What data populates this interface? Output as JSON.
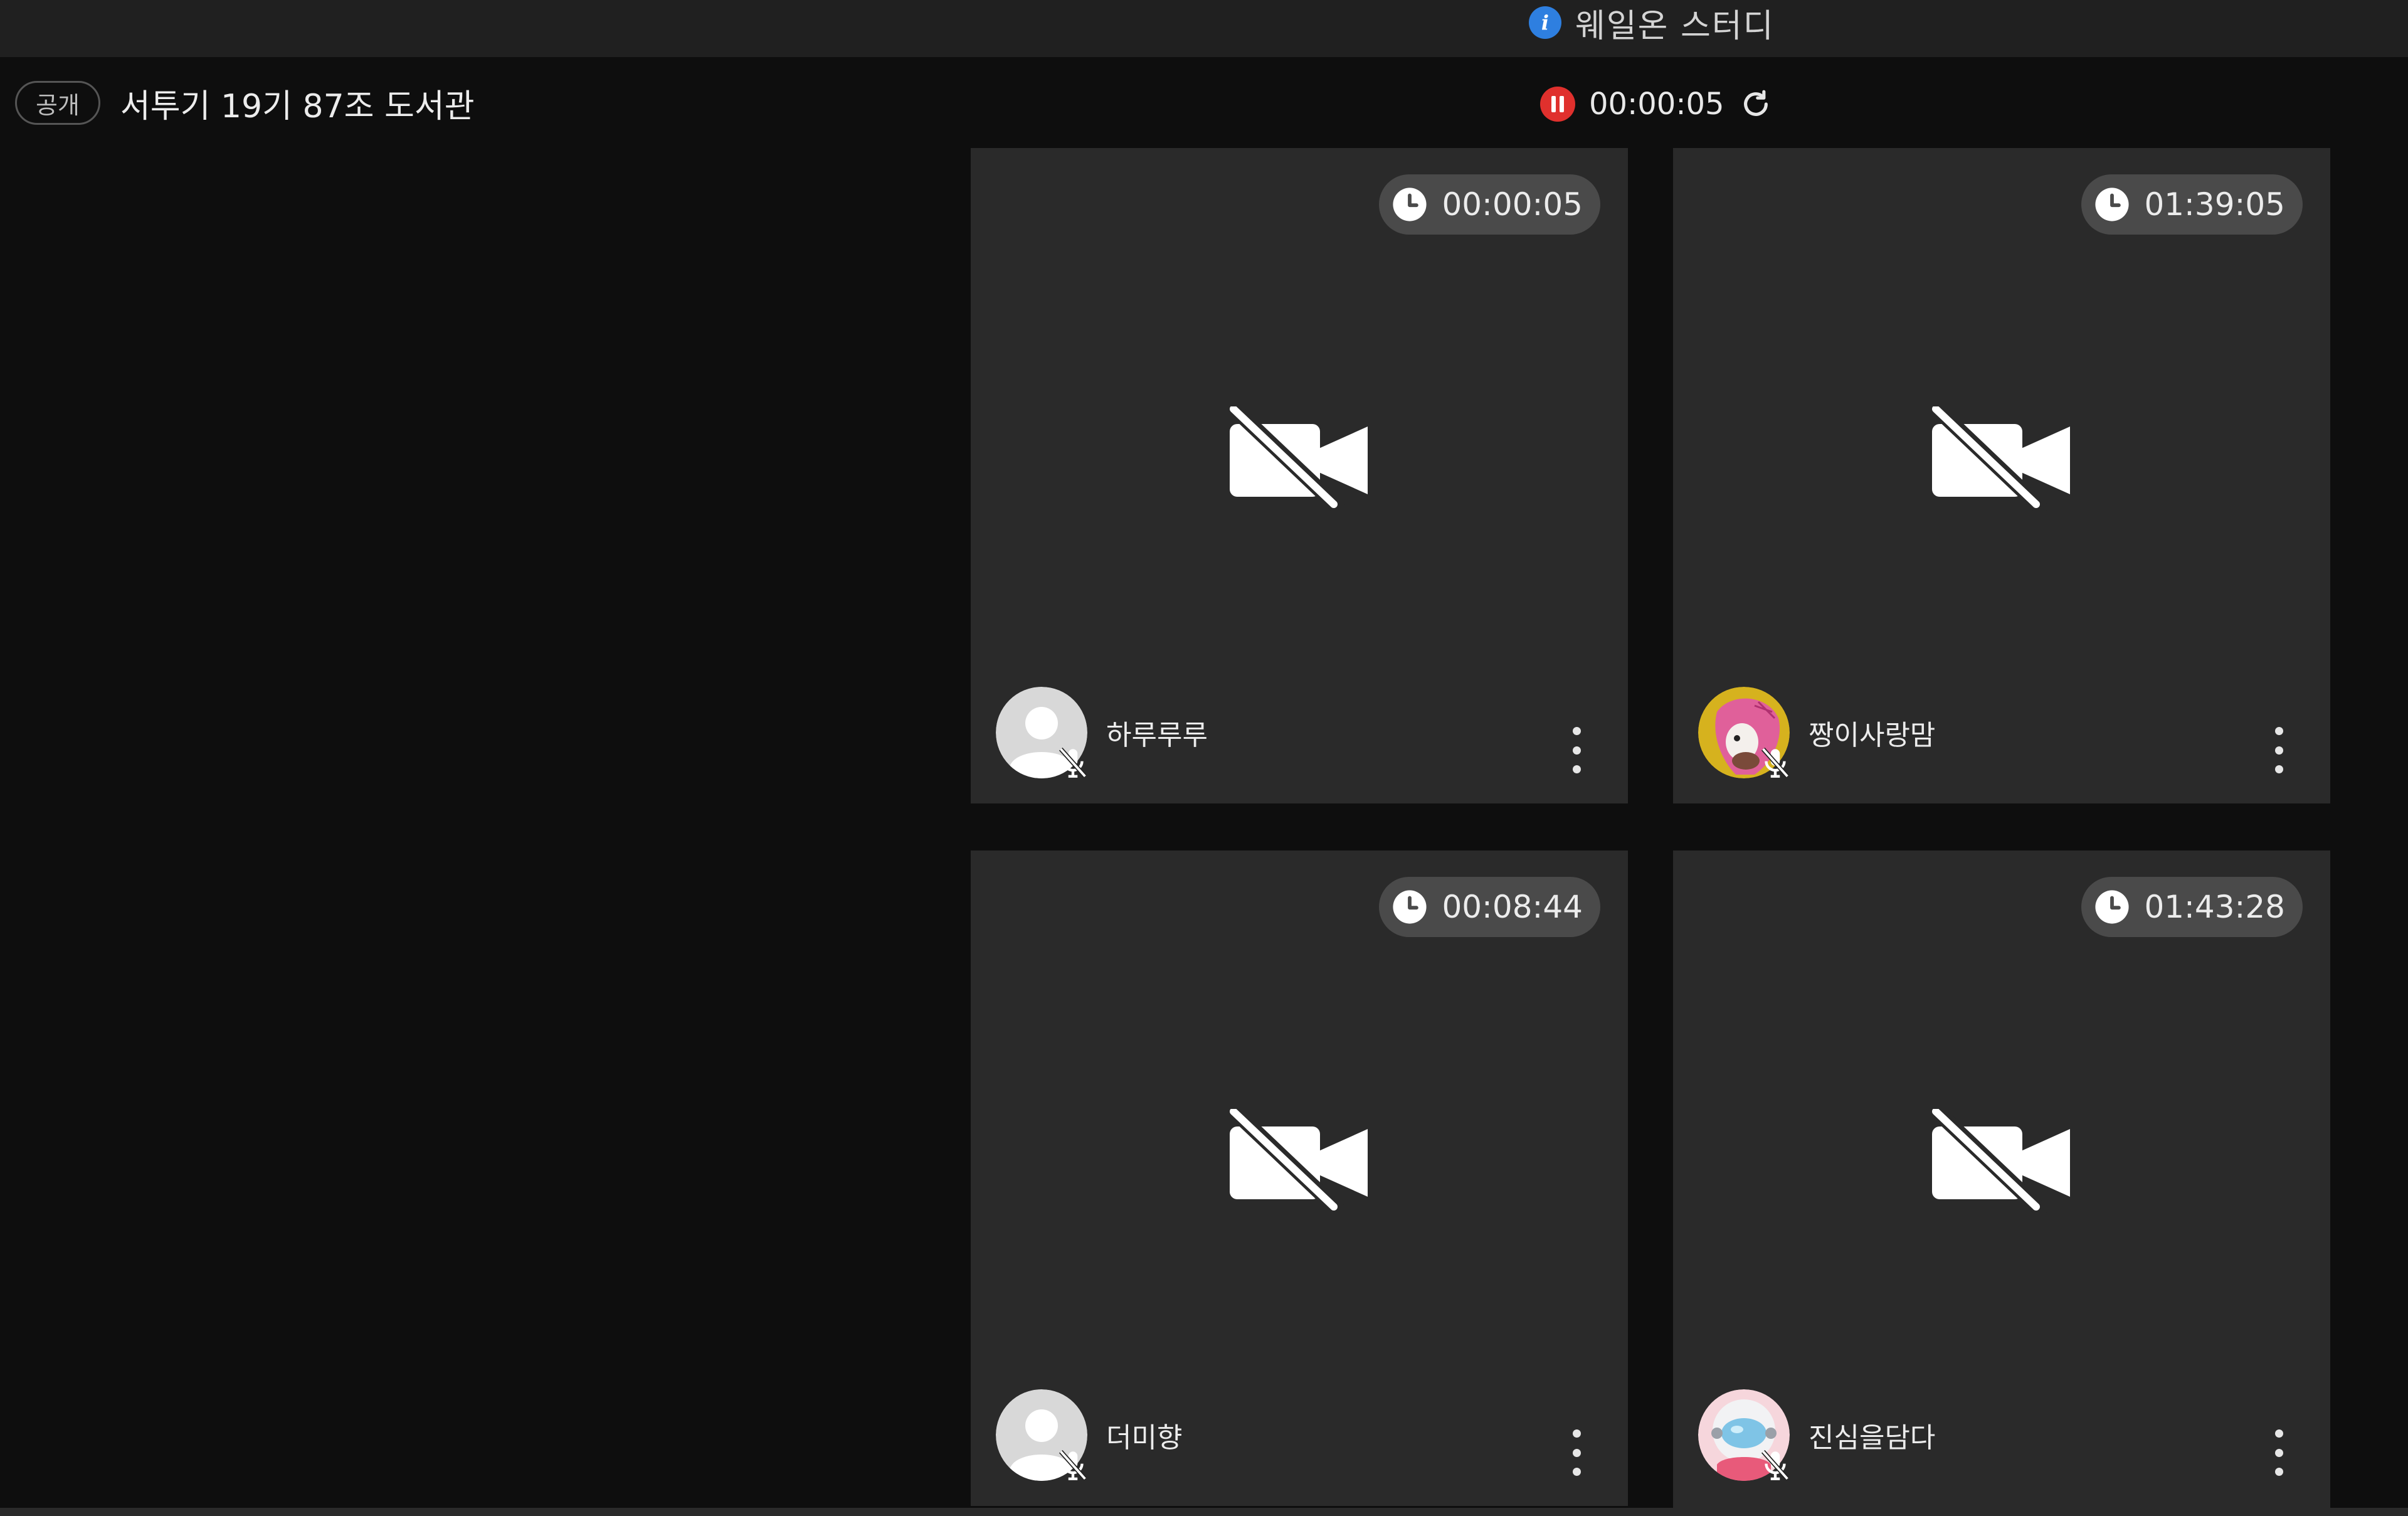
{
  "app": {
    "title": "웨일온 스터디"
  },
  "room": {
    "visibility_label": "공개",
    "title": "서투기 19기 87조 도서관"
  },
  "session": {
    "elapsed": "00:00:05"
  },
  "tiles": [
    {
      "name": "하루루루",
      "timer": "00:00:05",
      "avatar": "default",
      "mic": "muted",
      "camera": "off"
    },
    {
      "name": "짱이사랑맘",
      "timer": "01:39:05",
      "avatar": "pink-illustration",
      "mic": "muted",
      "camera": "off"
    },
    {
      "name": "더미향",
      "timer": "00:08:44",
      "avatar": "default",
      "mic": "muted",
      "camera": "off"
    },
    {
      "name": "진심을담다",
      "timer": "01:43:28",
      "avatar": "astronaut-illustration",
      "mic": "muted",
      "camera": "off"
    }
  ],
  "colors": {
    "accent_info": "#2e7fe0",
    "record_red": "#e0302d",
    "tile_bg": "#2a2a2a",
    "page_bg": "#0e0e0e"
  }
}
